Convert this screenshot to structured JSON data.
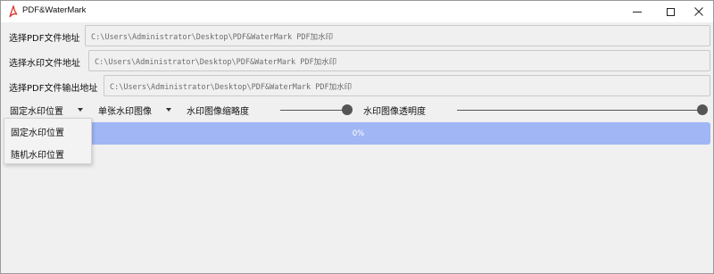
{
  "window": {
    "title": "PDF&WaterMark"
  },
  "rows": [
    {
      "button_label": "选择PDF文件地址",
      "path": "C:\\Users\\Administrator\\Desktop\\PDF&WaterMark PDF加水印"
    },
    {
      "button_label": "选择水印文件地址",
      "path": "C:\\Users\\Administrator\\Desktop\\PDF&WaterMark PDF加水印"
    },
    {
      "button_label": "选择PDF文件输出地址",
      "path": "C:\\Users\\Administrator\\Desktop\\PDF&WaterMark PDF加水印"
    }
  ],
  "controls": {
    "position_combo": "固定水印位置",
    "image_combo": "单张水印图像",
    "scale_label": "水印图像缩略度",
    "scale_value": 1.0,
    "opacity_label": "水印图像透明度",
    "opacity_value": 1.0
  },
  "progress": {
    "value": 0,
    "text": "0%"
  },
  "dropdown": {
    "options": [
      "固定水印位置",
      "随机水印位置"
    ]
  },
  "colors": {
    "progress_fill": "#a0b6f5",
    "app_icon": "#d9342b"
  }
}
